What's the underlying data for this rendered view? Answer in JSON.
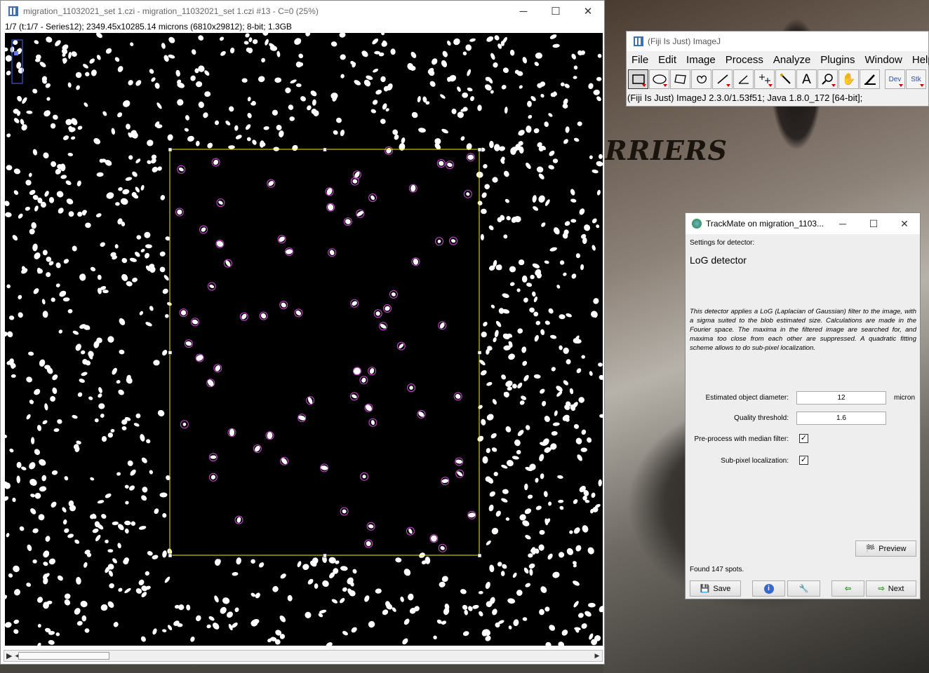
{
  "image_window": {
    "title": "migration_11032021_set 1.czi - migration_11032021_set 1.czi #13 - C=0 (25%)",
    "info": "1/7 (t:1/7 - Series12); 2349.45x10285.14 microns (6810x29812); 8-bit; 1.3GB",
    "minimize": "─",
    "maximize": "☐",
    "close": "✕"
  },
  "imagej_window": {
    "title": "(Fiji Is Just) ImageJ",
    "menus": [
      "File",
      "Edit",
      "Image",
      "Process",
      "Analyze",
      "Plugins",
      "Window",
      "Help"
    ],
    "tools": [
      "rectangle-icon",
      "oval-icon",
      "polygon-icon",
      "freehand-icon",
      "line-icon",
      "angle-icon",
      "multipoint-icon",
      "wand-icon",
      "text-icon",
      "magnifier-icon",
      "hand-icon",
      "color-picker-icon"
    ],
    "tool_dev": "Dev",
    "tool_stk": "Stk",
    "status": "(Fiji Is Just) ImageJ 2.3.0/1.53f51; Java 1.8.0_172 [64-bit];"
  },
  "trackmate": {
    "title": "TrackMate on migration_1103...",
    "settings_label": "Settings for detector:",
    "detector_name": "LoG detector",
    "description": "This detector applies a LoG (Laplacian of Gaussian) filter to the image, with a sigma suited to the blob estimated size. Calculations are made in the Fourier space. The maxima in the filtered image are searched for, and maxima too close from each other are suppressed. A quadratic fitting scheme allows to do sub-pixel localization.",
    "diameter_label": "Estimated object diameter:",
    "diameter_value": "12",
    "diameter_unit": "micron",
    "quality_label": "Quality threshold:",
    "quality_value": "1.6",
    "median_label": "Pre-process with median filter:",
    "median_checked": true,
    "subpixel_label": "Sub-pixel localization:",
    "subpixel_checked": true,
    "preview_label": "Preview",
    "found_text": "Found 147 spots.",
    "save_label": "Save",
    "next_label": "Next"
  },
  "desktop_text": "RRIERS"
}
